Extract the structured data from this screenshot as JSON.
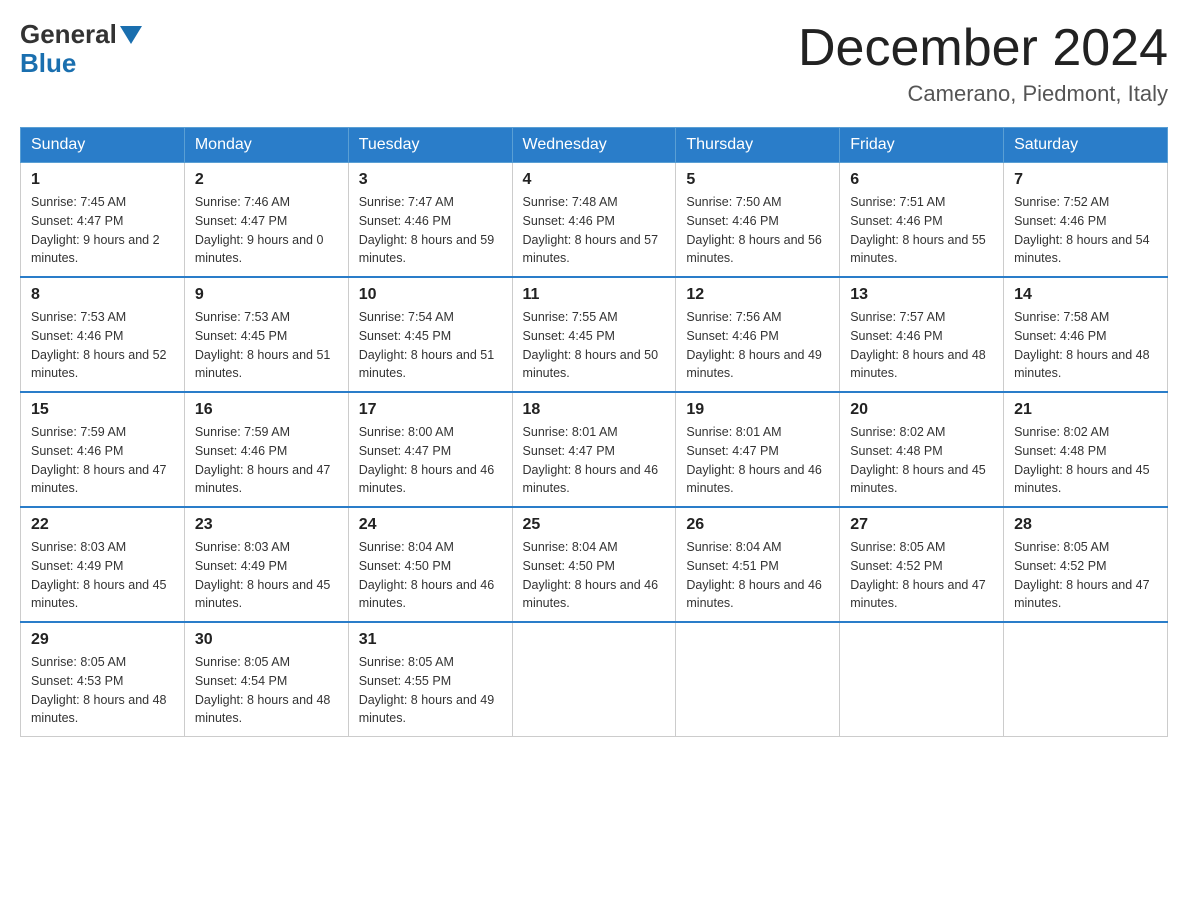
{
  "logo": {
    "line1": "General",
    "line2": "Blue"
  },
  "title": "December 2024",
  "location": "Camerano, Piedmont, Italy",
  "days_header": [
    "Sunday",
    "Monday",
    "Tuesday",
    "Wednesday",
    "Thursday",
    "Friday",
    "Saturday"
  ],
  "weeks": [
    [
      {
        "num": "1",
        "sunrise": "7:45 AM",
        "sunset": "4:47 PM",
        "daylight": "9 hours and 2 minutes."
      },
      {
        "num": "2",
        "sunrise": "7:46 AM",
        "sunset": "4:47 PM",
        "daylight": "9 hours and 0 minutes."
      },
      {
        "num": "3",
        "sunrise": "7:47 AM",
        "sunset": "4:46 PM",
        "daylight": "8 hours and 59 minutes."
      },
      {
        "num": "4",
        "sunrise": "7:48 AM",
        "sunset": "4:46 PM",
        "daylight": "8 hours and 57 minutes."
      },
      {
        "num": "5",
        "sunrise": "7:50 AM",
        "sunset": "4:46 PM",
        "daylight": "8 hours and 56 minutes."
      },
      {
        "num": "6",
        "sunrise": "7:51 AM",
        "sunset": "4:46 PM",
        "daylight": "8 hours and 55 minutes."
      },
      {
        "num": "7",
        "sunrise": "7:52 AM",
        "sunset": "4:46 PM",
        "daylight": "8 hours and 54 minutes."
      }
    ],
    [
      {
        "num": "8",
        "sunrise": "7:53 AM",
        "sunset": "4:46 PM",
        "daylight": "8 hours and 52 minutes."
      },
      {
        "num": "9",
        "sunrise": "7:53 AM",
        "sunset": "4:45 PM",
        "daylight": "8 hours and 51 minutes."
      },
      {
        "num": "10",
        "sunrise": "7:54 AM",
        "sunset": "4:45 PM",
        "daylight": "8 hours and 51 minutes."
      },
      {
        "num": "11",
        "sunrise": "7:55 AM",
        "sunset": "4:45 PM",
        "daylight": "8 hours and 50 minutes."
      },
      {
        "num": "12",
        "sunrise": "7:56 AM",
        "sunset": "4:46 PM",
        "daylight": "8 hours and 49 minutes."
      },
      {
        "num": "13",
        "sunrise": "7:57 AM",
        "sunset": "4:46 PM",
        "daylight": "8 hours and 48 minutes."
      },
      {
        "num": "14",
        "sunrise": "7:58 AM",
        "sunset": "4:46 PM",
        "daylight": "8 hours and 48 minutes."
      }
    ],
    [
      {
        "num": "15",
        "sunrise": "7:59 AM",
        "sunset": "4:46 PM",
        "daylight": "8 hours and 47 minutes."
      },
      {
        "num": "16",
        "sunrise": "7:59 AM",
        "sunset": "4:46 PM",
        "daylight": "8 hours and 47 minutes."
      },
      {
        "num": "17",
        "sunrise": "8:00 AM",
        "sunset": "4:47 PM",
        "daylight": "8 hours and 46 minutes."
      },
      {
        "num": "18",
        "sunrise": "8:01 AM",
        "sunset": "4:47 PM",
        "daylight": "8 hours and 46 minutes."
      },
      {
        "num": "19",
        "sunrise": "8:01 AM",
        "sunset": "4:47 PM",
        "daylight": "8 hours and 46 minutes."
      },
      {
        "num": "20",
        "sunrise": "8:02 AM",
        "sunset": "4:48 PM",
        "daylight": "8 hours and 45 minutes."
      },
      {
        "num": "21",
        "sunrise": "8:02 AM",
        "sunset": "4:48 PM",
        "daylight": "8 hours and 45 minutes."
      }
    ],
    [
      {
        "num": "22",
        "sunrise": "8:03 AM",
        "sunset": "4:49 PM",
        "daylight": "8 hours and 45 minutes."
      },
      {
        "num": "23",
        "sunrise": "8:03 AM",
        "sunset": "4:49 PM",
        "daylight": "8 hours and 45 minutes."
      },
      {
        "num": "24",
        "sunrise": "8:04 AM",
        "sunset": "4:50 PM",
        "daylight": "8 hours and 46 minutes."
      },
      {
        "num": "25",
        "sunrise": "8:04 AM",
        "sunset": "4:50 PM",
        "daylight": "8 hours and 46 minutes."
      },
      {
        "num": "26",
        "sunrise": "8:04 AM",
        "sunset": "4:51 PM",
        "daylight": "8 hours and 46 minutes."
      },
      {
        "num": "27",
        "sunrise": "8:05 AM",
        "sunset": "4:52 PM",
        "daylight": "8 hours and 47 minutes."
      },
      {
        "num": "28",
        "sunrise": "8:05 AM",
        "sunset": "4:52 PM",
        "daylight": "8 hours and 47 minutes."
      }
    ],
    [
      {
        "num": "29",
        "sunrise": "8:05 AM",
        "sunset": "4:53 PM",
        "daylight": "8 hours and 48 minutes."
      },
      {
        "num": "30",
        "sunrise": "8:05 AM",
        "sunset": "4:54 PM",
        "daylight": "8 hours and 48 minutes."
      },
      {
        "num": "31",
        "sunrise": "8:05 AM",
        "sunset": "4:55 PM",
        "daylight": "8 hours and 49 minutes."
      },
      null,
      null,
      null,
      null
    ]
  ]
}
